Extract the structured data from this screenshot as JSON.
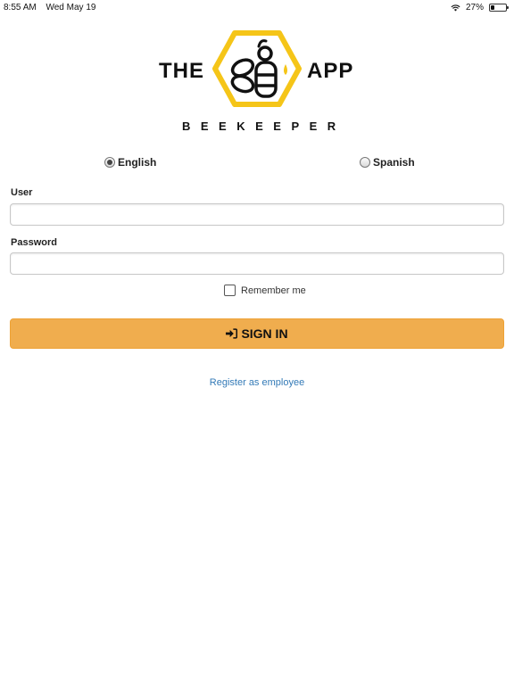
{
  "status_bar": {
    "time": "8:55 AM",
    "date": "Wed May 19",
    "battery_percent": "27%",
    "battery_level": 0.27,
    "wifi_icon": "wifi-icon",
    "battery_icon": "battery-icon"
  },
  "logo": {
    "left_word": "THE",
    "right_word": "APP",
    "subtitle": "BEEKEEPER",
    "icon": "bee-icon",
    "colors": {
      "hex": "#f5c518",
      "dark": "#111111",
      "drop": "#f5c518"
    }
  },
  "language": {
    "options": [
      {
        "label": "English",
        "selected": true
      },
      {
        "label": "Spanish",
        "selected": false
      }
    ]
  },
  "form": {
    "user_label": "User",
    "user_value": "",
    "password_label": "Password",
    "password_value": "",
    "remember_label": "Remember me",
    "remember_checked": false,
    "signin_label": "SIGN IN",
    "signin_icon": "sign-in-icon"
  },
  "register_link": "Register as employee",
  "colors": {
    "primary_button": "#f0ad4e",
    "link": "#337ab7"
  }
}
